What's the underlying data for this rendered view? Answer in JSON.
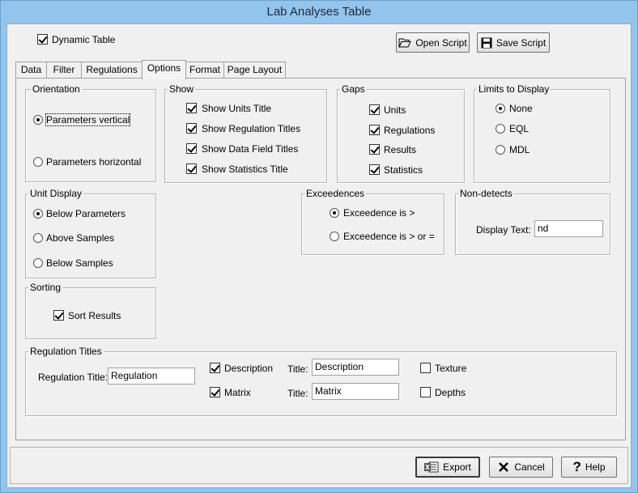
{
  "window": {
    "title": "Lab Analyses Table"
  },
  "top": {
    "dynamic_table_label": "Dynamic Table",
    "dynamic_table_checked": true,
    "open_script_label": "Open Script",
    "save_script_label": "Save Script"
  },
  "tabs": [
    {
      "label": "Data"
    },
    {
      "label": "Filter"
    },
    {
      "label": "Regulations"
    },
    {
      "label": "Options",
      "active": true
    },
    {
      "label": "Format"
    },
    {
      "label": "Page Layout"
    }
  ],
  "orientation": {
    "title": "Orientation",
    "options": [
      {
        "label": "Parameters vertical",
        "selected": true
      },
      {
        "label": "Parameters horizontal",
        "selected": false
      }
    ]
  },
  "show": {
    "title": "Show",
    "items": [
      {
        "label": "Show Units Title",
        "checked": true
      },
      {
        "label": "Show Regulation Titles",
        "checked": true
      },
      {
        "label": "Show Data Field Titles",
        "checked": true
      },
      {
        "label": "Show Statistics Title",
        "checked": true
      }
    ]
  },
  "gaps": {
    "title": "Gaps",
    "items": [
      {
        "label": "Units",
        "checked": true
      },
      {
        "label": "Regulations",
        "checked": true
      },
      {
        "label": "Results",
        "checked": true
      },
      {
        "label": "Statistics",
        "checked": true
      }
    ]
  },
  "limits": {
    "title": "Limits to Display",
    "options": [
      {
        "label": "None",
        "selected": true
      },
      {
        "label": "EQL",
        "selected": false
      },
      {
        "label": "MDL",
        "selected": false
      }
    ]
  },
  "unit_display": {
    "title": "Unit Display",
    "options": [
      {
        "label": "Below Parameters",
        "selected": true
      },
      {
        "label": "Above Samples",
        "selected": false
      },
      {
        "label": "Below Samples",
        "selected": false
      }
    ]
  },
  "exceedences": {
    "title": "Exceedences",
    "options": [
      {
        "label": "Exceedence is >",
        "selected": true
      },
      {
        "label": "Exceedence is > or =",
        "selected": false
      }
    ]
  },
  "non_detects": {
    "title": "Non-detects",
    "display_text_label": "Display Text:",
    "display_text_value": "nd"
  },
  "sorting": {
    "title": "Sorting",
    "sort_results_label": "Sort Results",
    "sort_results_checked": true
  },
  "regulation_titles": {
    "title": "Regulation Titles",
    "regulation_title_label": "Regulation Title:",
    "regulation_title_value": "Regulation",
    "description_label": "Description",
    "description_checked": true,
    "description_title_label": "Title:",
    "description_title_value": "Description",
    "matrix_label": "Matrix",
    "matrix_checked": true,
    "matrix_title_label": "Title:",
    "matrix_title_value": "Matrix",
    "texture_label": "Texture",
    "texture_checked": false,
    "depths_label": "Depths",
    "depths_checked": false
  },
  "buttons": {
    "export_label": "Export",
    "cancel_label": "Cancel",
    "help_label": "Help"
  }
}
